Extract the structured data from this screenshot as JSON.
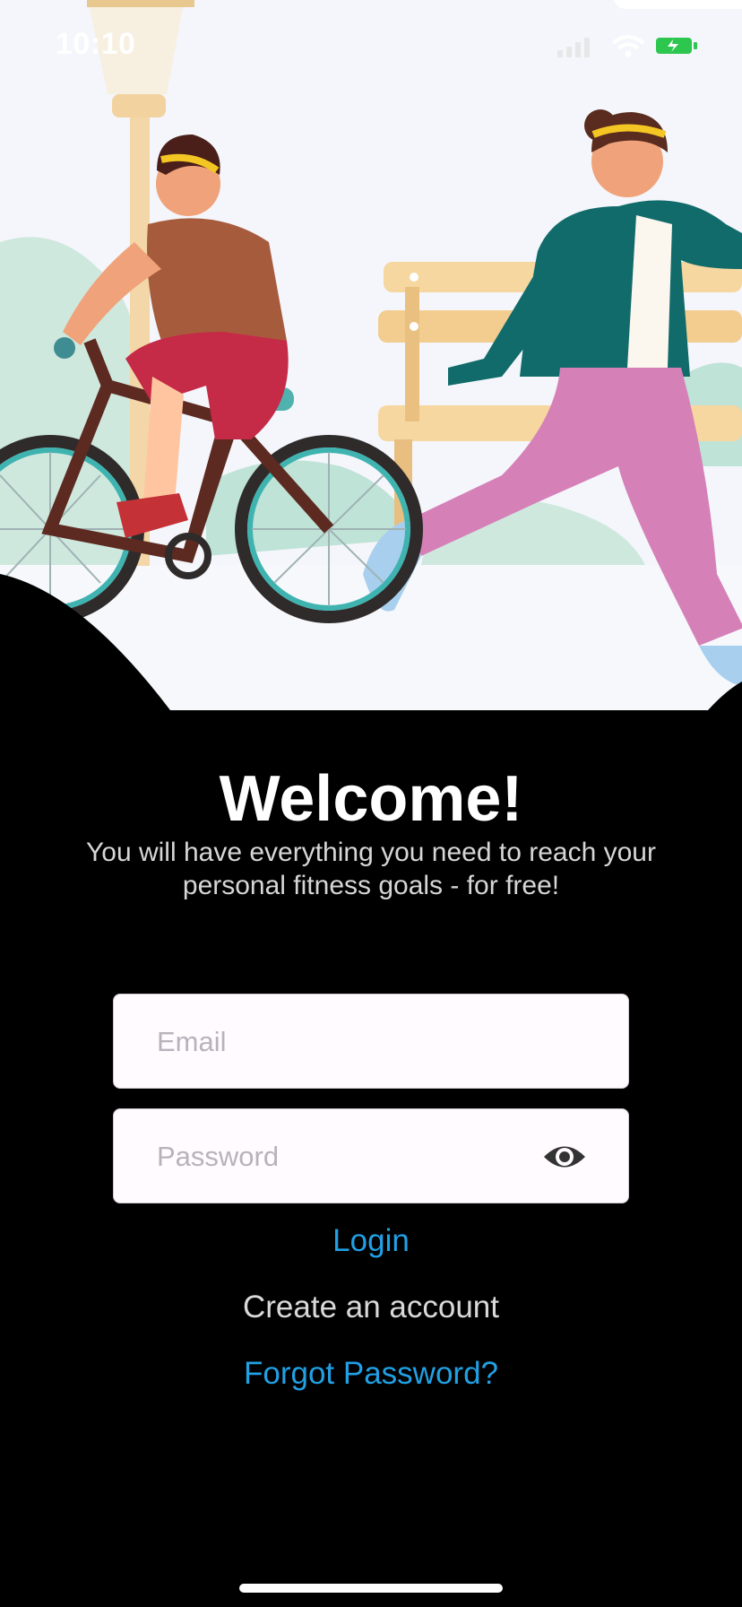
{
  "status_bar": {
    "time": "10:10"
  },
  "hero": {
    "illustration": "park-cyclist-runner"
  },
  "welcome": {
    "title": "Welcome!",
    "subtitle_line1": "You will have everything you need to reach your",
    "subtitle_line2": "personal fitness goals - for free!"
  },
  "form": {
    "email_placeholder": "Email",
    "password_placeholder": "Password",
    "show_password_icon": "eye-icon"
  },
  "actions": {
    "login": "Login",
    "create_account": "Create an account",
    "forgot_password": "Forgot Password?"
  },
  "colors": {
    "accent": "#21a0e3",
    "background": "#000000",
    "field": "#fffbfe"
  }
}
